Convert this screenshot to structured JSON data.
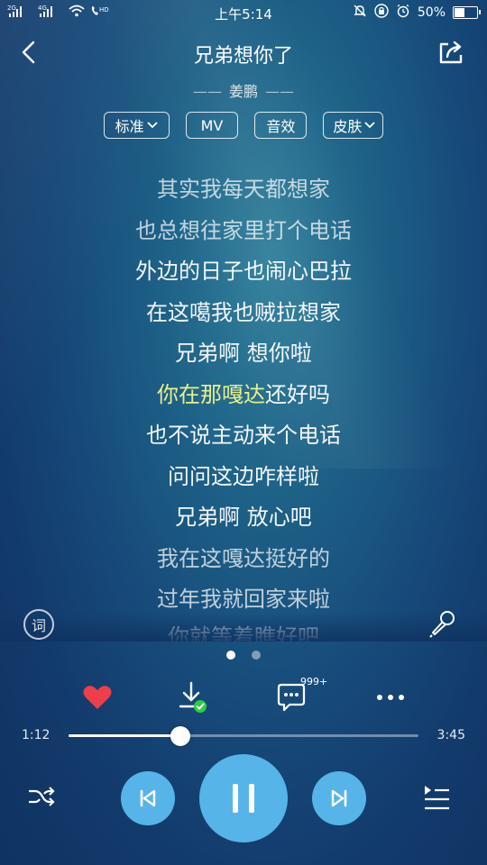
{
  "status_bar": {
    "network_left": "2G",
    "network_right": "4G",
    "hd": "HD",
    "time": "上午5:14",
    "battery": "50%",
    "battery_level": 0.5
  },
  "header": {
    "title": "兄弟想你了",
    "artist": "姜鹏"
  },
  "pills": [
    {
      "label": "标准",
      "has_caret": true
    },
    {
      "label": "MV",
      "has_caret": false
    },
    {
      "label": "音效",
      "has_caret": false
    },
    {
      "label": "皮肤",
      "has_caret": true
    }
  ],
  "lyrics": {
    "lines": [
      {
        "text": "其实我每天都想家",
        "dim": true
      },
      {
        "text": "也总想往家里打个电话",
        "dim": true
      },
      {
        "text": "外边的日子也闹心巴拉",
        "dim": false
      },
      {
        "text": "在这噶我也贼拉想家",
        "dim": false
      },
      {
        "text": "兄弟啊 想你啦",
        "dim": false
      },
      {
        "text": "",
        "dim": false
      },
      {
        "text": "也不说主动来个电话",
        "dim": false
      },
      {
        "text": "问问这边咋样啦",
        "dim": false
      },
      {
        "text": "兄弟啊 放心吧",
        "dim": false
      },
      {
        "text": "我在这嘎达挺好的",
        "dim": true
      },
      {
        "text": "过年我就回家来啦",
        "dim": true
      },
      {
        "text": "你就等着瞧好吧",
        "dim": true
      }
    ],
    "current_highlight": "你在那嘎达",
    "current_rest": "还好吗",
    "lyric_button": "词"
  },
  "actions": {
    "comment_count": "999+"
  },
  "player": {
    "current_time": "1:12",
    "total_time": "3:45",
    "progress": 0.32
  },
  "colors": {
    "accent": "#56b4e8",
    "heart": "#ef3e4a",
    "highlight": "#e8f08a",
    "check": "#2ecc40"
  }
}
